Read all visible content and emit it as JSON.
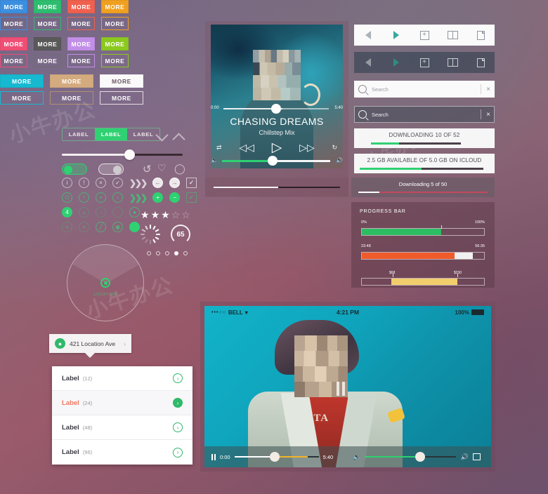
{
  "watermarks": [
    "小牛办公",
    "小牛办公",
    "小牛办公",
    "小牛办公",
    "小牛办公",
    "小牛办公"
  ],
  "buttons": {
    "label": "MORE",
    "rows": [
      {
        "solid": [
          {
            "label": "MORE",
            "color": "#3b8fe0"
          },
          {
            "label": "MORE",
            "color": "#2dbd6e"
          },
          {
            "label": "MORE",
            "color": "#f0604f"
          },
          {
            "label": "MORE",
            "color": "#f0a020"
          }
        ]
      },
      {
        "ghost": [
          {
            "label": "MORE",
            "color": "#3b8fe0"
          },
          {
            "label": "MORE",
            "color": "#2dbd6e"
          },
          {
            "label": "MORE",
            "color": "#f0604f"
          },
          {
            "label": "MORE",
            "color": "#f0a020"
          }
        ]
      },
      {
        "solid": [
          {
            "label": "MORE",
            "color": "#f04e74"
          },
          {
            "label": "MORE",
            "color": "#595959"
          },
          {
            "label": "MORE",
            "color": "#c28fe8"
          },
          {
            "label": "MORE",
            "color": "#8cc920"
          }
        ]
      },
      {
        "ghost": [
          {
            "label": "MORE",
            "color": "#f04e74"
          },
          {
            "label": "MORE",
            "color": "#595959"
          },
          {
            "label": "MORE",
            "color": "#c28fe8"
          },
          {
            "label": "MORE",
            "color": "#8cc920"
          }
        ]
      }
    ],
    "wide_rows": [
      {
        "solid": [
          {
            "label": "MORE",
            "color": "#16b9d0"
          },
          {
            "label": "MORE",
            "color": "#d4ab7f"
          },
          {
            "label": "MORE",
            "color": "#fbfafb",
            "text": "#6a5a62"
          }
        ]
      },
      {
        "ghost": [
          {
            "label": "MORE",
            "color": "#16b9d0"
          },
          {
            "label": "MORE",
            "color": "#d4ab7f"
          },
          {
            "label": "MORE",
            "color": "#fbfafb"
          }
        ]
      }
    ]
  },
  "segmented": {
    "options": [
      "LABEL",
      "LABEL",
      "LABEL"
    ],
    "active_index": 1,
    "active_color": "#2fd172"
  },
  "slider": {
    "value_percent": 57
  },
  "toggles": [
    {
      "state": "on",
      "color": "#2fd172"
    },
    {
      "state": "off",
      "color": "#cfcacd"
    }
  ],
  "social_icons": [
    "share-icon",
    "heart-icon",
    "comment-icon"
  ],
  "icon_grid": {
    "row1": [
      "info-icon",
      "alert-icon",
      "close-icon",
      "check-icon",
      "chevrons-right-icon",
      "arrow-left-icon",
      "arrow-right-icon",
      "checkbox-checked-icon"
    ],
    "row2": [
      "power-icon",
      "alert-icon",
      "close-icon",
      "back-icon",
      "chevrons-right-icon",
      "add-icon",
      "minus-icon",
      "checkbox-checked-icon"
    ],
    "row3": [
      "badge-4-icon",
      "warning-icon",
      "clock-icon",
      "circle-icon",
      "record-icon"
    ],
    "row4": [
      "pin-icon",
      "person-icon",
      "edit-icon",
      "target-icon",
      "dot-icon"
    ]
  },
  "rating": {
    "value": 3,
    "max": 5
  },
  "gauge": {
    "value": "65"
  },
  "pagination_dots": {
    "count": 5,
    "active_index": 3
  },
  "radar": {
    "center_label": "LOCATION"
  },
  "location_pill": {
    "address": "421 Location Ave",
    "avatar": "person-icon",
    "chevron": "chevron-right-icon"
  },
  "list_card": {
    "rows": [
      {
        "label": "Label",
        "count": "(12)",
        "active": false
      },
      {
        "label": "Label",
        "count": "(24)",
        "active": true
      },
      {
        "label": "Label",
        "count": "(48)",
        "active": false
      },
      {
        "label": "Label",
        "count": "(96)",
        "active": false
      }
    ]
  },
  "music_player": {
    "title": "CHASING DREAMS",
    "subtitle": "Chillstep Mix",
    "time_current": "0:00",
    "time_total": "5:40",
    "seek_percent": 48,
    "volume_percent": 40,
    "controls": {
      "shuffle": "shuffle-icon",
      "prev": "previous-icon",
      "play": "play-icon",
      "next": "next-icon",
      "repeat": "repeat-icon",
      "volume_min": "volume-mute-icon",
      "volume_max": "volume-up-icon"
    }
  },
  "strip_right": {
    "label": "Downloading  5  of 50",
    "progress_percent": 15
  },
  "toolbars": {
    "light": [
      "back-icon",
      "forward-icon",
      "add-icon",
      "bookmarks-icon",
      "page-icon"
    ],
    "dark": [
      "back-icon",
      "forward-icon",
      "add-icon",
      "bookmarks-icon",
      "page-icon"
    ]
  },
  "search": {
    "light": {
      "placeholder": "Search",
      "value": "",
      "clear": "close-icon",
      "icon": "search-icon"
    },
    "dark": {
      "placeholder": "Search",
      "value": "",
      "clear": "close-icon",
      "icon": "search-icon"
    }
  },
  "downloads": [
    {
      "label": "DOWNLOADING 10 OF 52",
      "progress_percent": 23
    },
    {
      "label": "2.5 GB AVAILABLE OF 5.0 GB ON ICLOUD",
      "progress_percent": 50
    }
  ],
  "progress_panel": {
    "title": "PROGRESS BAR",
    "bars": [
      {
        "left_label": "0%",
        "right_label": "100%",
        "fill_percent": 65,
        "color": "#2cbd62",
        "marker_percent": 65
      },
      {
        "left_label": "23:48",
        "right_label": "56:35",
        "fill_percent": 75,
        "color": "#ef5b2b",
        "buffer_percent": 90
      },
      {
        "left_label": "",
        "right_label": "",
        "fill_percent": 52,
        "color": "#f2cd6b",
        "offset_percent": 24,
        "mark_low": "$68",
        "mark_high": "$230"
      }
    ]
  },
  "video_player": {
    "status_bar": {
      "signal": "•••○○",
      "carrier": "BELL",
      "wifi": "wifi-icon",
      "time": "4:21 PM",
      "battery_percent": "100%"
    },
    "time_current": "0:00",
    "time_total": "5:40",
    "seek_percent": 42,
    "volume_percent": 55,
    "controls": {
      "pause": "pause-icon",
      "volume_min": "volume-mute-icon",
      "volume_max": "volume-up-icon",
      "fullscreen": "fullscreen-icon"
    }
  }
}
